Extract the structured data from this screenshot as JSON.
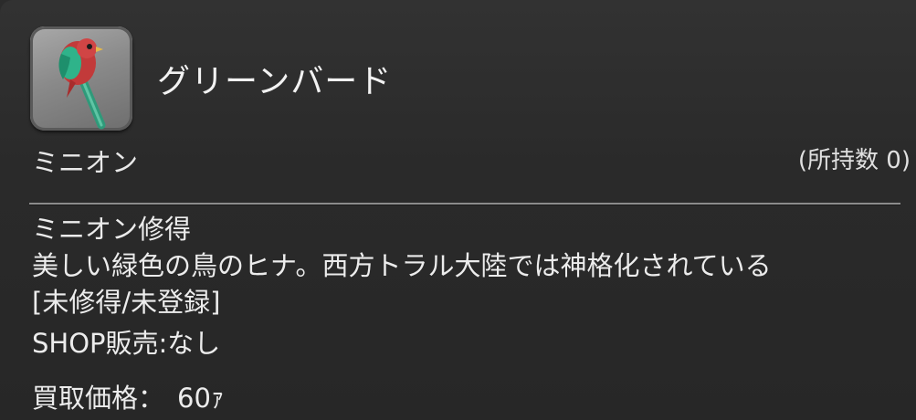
{
  "item": {
    "name": "グリーンバード",
    "category": "ミニオン",
    "owned_count": "(所持数 0)",
    "icon": "green-bird-minion-icon"
  },
  "details": {
    "effect": "ミニオン修得",
    "description": "美しい緑色の鳥のヒナ。西方トラル大陸では神格化されている",
    "status": "[未修得/未登録]",
    "shop": "SHOP販売:なし",
    "price_label": "買取価格：",
    "price_value": "60ｧ"
  },
  "colors": {
    "background": "#2b2b2b",
    "text": "#ececec",
    "divider": "#8c8c8c"
  }
}
